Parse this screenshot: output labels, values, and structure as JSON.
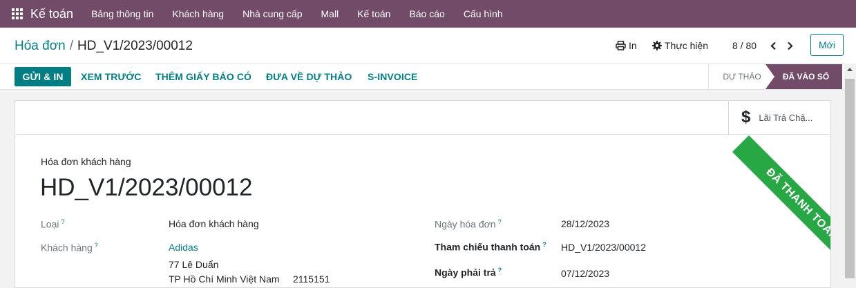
{
  "navbar": {
    "app_name": "Kế toán",
    "menu": [
      "Bảng thông tin",
      "Khách hàng",
      "Nhà cung cấp",
      "Mall",
      "Kế toán",
      "Báo cáo",
      "Cấu hình"
    ]
  },
  "breadcrumb": {
    "parent": "Hóa đơn",
    "separator": "/",
    "current": "HD_V1/2023/00012"
  },
  "toolbar": {
    "print_label": "In",
    "action_label": "Thực hiện",
    "new_label": "Mới"
  },
  "pager": {
    "value": "8 / 80"
  },
  "statusbar": {
    "buttons": [
      "Gửi & In",
      "Xem trước",
      "Thêm giấy báo có",
      "Đưa về dự thảo",
      "S-Invoice"
    ],
    "stages": {
      "draft": "DỰ THẢO",
      "posted": "ĐÃ VÀO SỔ"
    }
  },
  "smart_button": {
    "label": "Lãi Trả Chậ..."
  },
  "ribbon": "ĐÃ THANH TOÁN",
  "document": {
    "subtitle": "Hóa đơn khách hàng",
    "title": "HD_V1/2023/00012"
  },
  "fields": {
    "type_label": "Loại",
    "type_value": "Hóa đơn khách hàng",
    "customer_label": "Khách hàng",
    "customer_name": "Adidas",
    "customer_address1": "77 Lê Duẩn",
    "customer_address2": "TP Hồ Chí Minh Việt Nam     2115151",
    "invoice_date_label": "Ngày hóa đơn",
    "invoice_date_value": "28/12/2023",
    "payment_ref_label": "Tham chiếu thanh toán",
    "payment_ref_value": "HD_V1/2023/00012",
    "due_date_label": "Ngày phải trả",
    "due_date_value": "07/12/2023",
    "help_mark": "?"
  },
  "colors": {
    "brand": "#714b67",
    "accent": "#017e84",
    "paid": "#28a745"
  },
  "icons": [
    "apps-grid-icon",
    "print-icon",
    "gear-icon",
    "chevron-left-icon",
    "chevron-right-icon",
    "dollar-icon"
  ]
}
